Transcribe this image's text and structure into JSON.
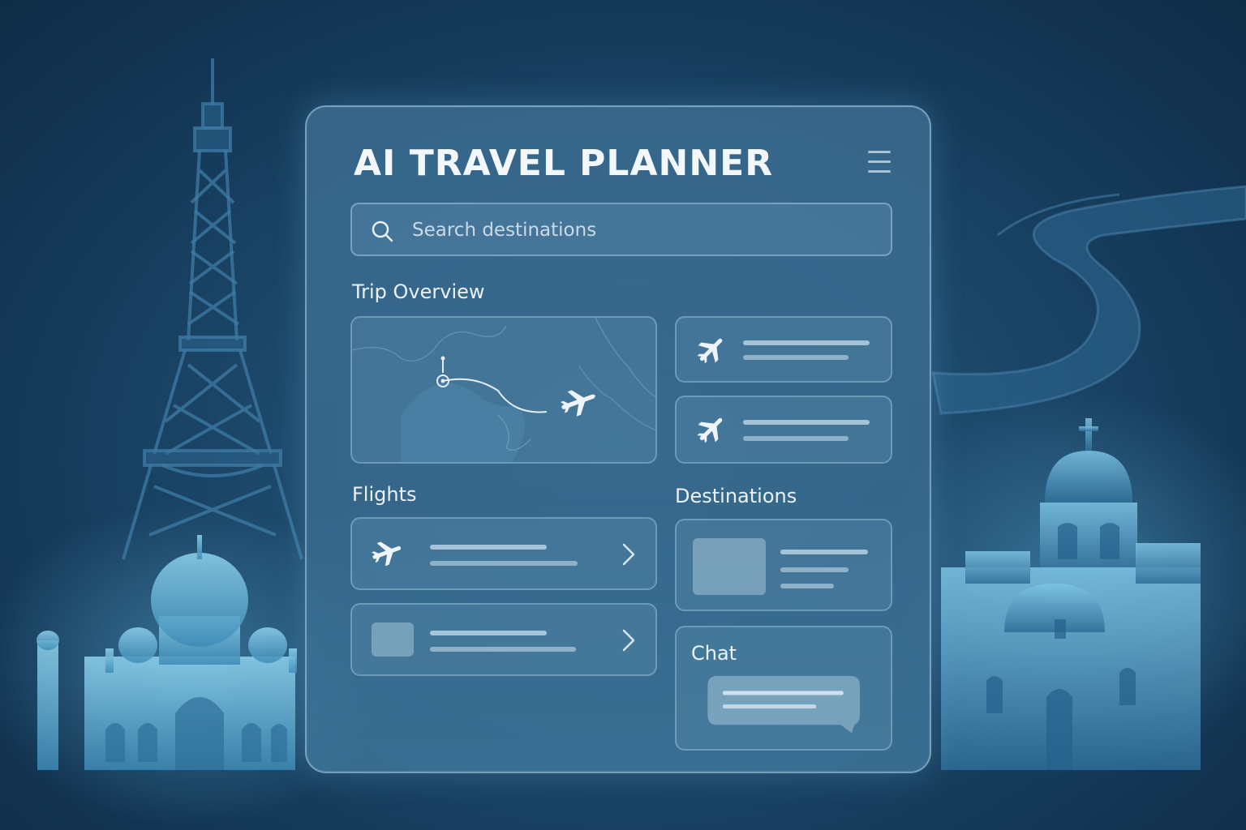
{
  "app": {
    "title": "AI TRAVEL PLANNER"
  },
  "header": {
    "menu_icon": "hamburger-menu-icon"
  },
  "search": {
    "placeholder": "Search destinations",
    "icon": "search-icon"
  },
  "sections": {
    "trip_overview": "Trip Overview",
    "flights": "Flights",
    "destinations": "Destinations",
    "chat": "Chat"
  },
  "icons": {
    "plane": "airplane-icon",
    "chevron": "chevron-right-icon",
    "map_pin": "map-pin-icon"
  },
  "colors": {
    "background": "#1b4668",
    "panel": "#3e6e92",
    "text": "#f2f7fb",
    "accent": "#a6cfe6"
  },
  "background_landmarks": [
    "eiffel-tower",
    "taj-mahal",
    "great-wall",
    "domed-church"
  ]
}
